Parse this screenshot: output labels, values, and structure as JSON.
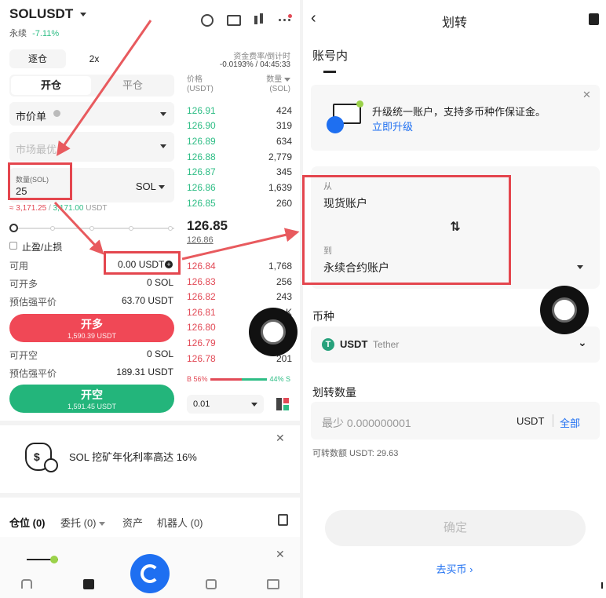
{
  "left": {
    "symbol": "SOLUSDT",
    "contract_type": "永续",
    "change": "-7.11%",
    "funding_label": "资金费率/倒计时",
    "funding_value": "-0.0193% / 04:45:33",
    "margin_mode": "逐仓",
    "leverage": "2x",
    "tab_open": "开仓",
    "tab_close": "平仓",
    "order_type": "市价单",
    "price_placeholder": "市场最优",
    "qty_label": "数量(SOL)",
    "qty_value": "25",
    "qty_unit": "SOL",
    "qty_approx_red": "≈ 3,171.25",
    "qty_approx_green": "3,171.00",
    "qty_approx_unit": "USDT",
    "tpsl_label": "止盈/止损",
    "available_label": "可用",
    "available_value": "0.00 USDT",
    "can_open_long_label": "可开多",
    "can_open_long_value": "0 SOL",
    "liq_price_label_1": "预估强平价",
    "liq_price_value_1": "63.70 USDT",
    "buy_label": "开多",
    "buy_sub": "1,590.39 USDT",
    "can_open_short_label": "可开空",
    "can_open_short_value": "0 SOL",
    "liq_price_label_2": "预估强平价",
    "liq_price_value_2": "189.31 USDT",
    "sell_label": "开空",
    "sell_sub": "1,591.45 USDT",
    "book_header_price": "价格",
    "book_header_price_unit": "(USDT)",
    "book_header_qty": "数量",
    "book_header_qty_unit": "(SOL)",
    "asks": [
      {
        "price": "126.91",
        "qty": "424"
      },
      {
        "price": "126.90",
        "qty": "319"
      },
      {
        "price": "126.89",
        "qty": "634"
      },
      {
        "price": "126.88",
        "qty": "2,779"
      },
      {
        "price": "126.87",
        "qty": "345"
      },
      {
        "price": "126.86",
        "qty": "1,639"
      },
      {
        "price": "126.85",
        "qty": "260"
      }
    ],
    "mid_price": "126.85",
    "mid_sub": "126.86",
    "bids": [
      {
        "price": "126.84",
        "qty": "1,768"
      },
      {
        "price": "126.83",
        "qty": "256"
      },
      {
        "price": "126.82",
        "qty": "243"
      },
      {
        "price": "126.81",
        "qty": "…K"
      },
      {
        "price": "126.80",
        "qty": ""
      },
      {
        "price": "126.79",
        "qty": ""
      },
      {
        "price": "126.78",
        "qty": "201"
      }
    ],
    "ratio_buy": "B 56%",
    "ratio_sell": "44% S",
    "ratio_buy_fraction": 0.56,
    "tick_size": "0.01",
    "promo_text": "SOL 挖矿年化利率高达 16%",
    "bottom_tabs": [
      "仓位 (0)",
      "委托 (0)",
      "资产",
      "机器人 (0)"
    ]
  },
  "right": {
    "title": "划转",
    "section_title": "账号内",
    "upgrade_text": "升级统一账户，支持多币种作保证金。",
    "upgrade_link": "立即升级",
    "from_label": "从",
    "from_value": "现货账户",
    "to_label": "到",
    "to_value": "永续合约账户",
    "coin_label": "币种",
    "coin_symbol": "USDT",
    "coin_name": "Tether",
    "amount_label": "划转数量",
    "amount_placeholder": "最少 0.000000001",
    "amount_unit": "USDT",
    "amount_all": "全部",
    "transferable": "可转数额 USDT: 29.63",
    "confirm": "确定",
    "buy_coin": "去买币"
  },
  "colors": {
    "green": "#2ebd85",
    "red": "#e24a56",
    "blue": "#1e6ff1",
    "annotation": "#e4464e"
  }
}
